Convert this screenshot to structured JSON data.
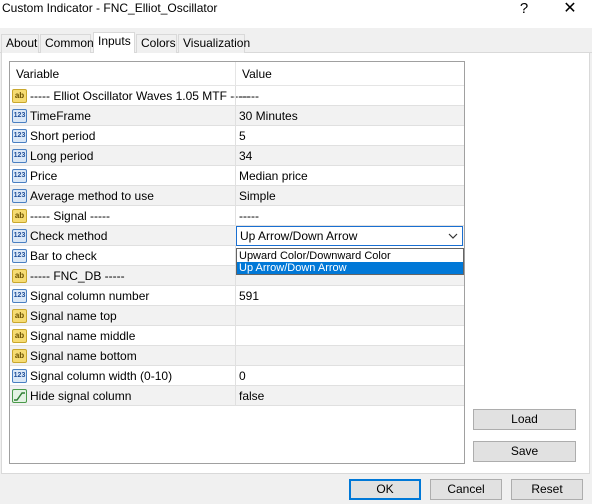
{
  "window": {
    "title": "Custom Indicator - FNC_Elliot_Oscillator",
    "help_glyph": "?",
    "close_glyph": "✕"
  },
  "tabs": [
    {
      "label": "About",
      "active": false
    },
    {
      "label": "Common",
      "active": false
    },
    {
      "label": "Inputs",
      "active": true
    },
    {
      "label": "Colors",
      "active": false
    },
    {
      "label": "Visualization",
      "active": false
    }
  ],
  "grid": {
    "header": {
      "variable": "Variable",
      "value": "Value"
    },
    "rows": [
      {
        "icon": "ab-icon",
        "variable": "----- Elliot Oscillator Waves 1.05 MTF -----",
        "value": "-----"
      },
      {
        "icon": "numeric-icon",
        "variable": "TimeFrame",
        "value": "30 Minutes"
      },
      {
        "icon": "numeric-icon",
        "variable": "Short period",
        "value": "5"
      },
      {
        "icon": "numeric-icon",
        "variable": "Long period",
        "value": "34"
      },
      {
        "icon": "numeric-icon",
        "variable": "Price",
        "value": "Median price"
      },
      {
        "icon": "numeric-icon",
        "variable": "Average method to use",
        "value": "Simple"
      },
      {
        "icon": "ab-icon",
        "variable": "----- Signal -----",
        "value": "-----"
      },
      {
        "icon": "numeric-icon",
        "variable": "Check method",
        "value": "Up Arrow/Down Arrow"
      },
      {
        "icon": "numeric-icon",
        "variable": "Bar to check",
        "value": ""
      },
      {
        "icon": "ab-icon",
        "variable": "----- FNC_DB -----",
        "value": ""
      },
      {
        "icon": "numeric-icon",
        "variable": "Signal column number",
        "value": "591"
      },
      {
        "icon": "ab-icon",
        "variable": "Signal name top",
        "value": ""
      },
      {
        "icon": "ab-icon",
        "variable": "Signal name middle",
        "value": ""
      },
      {
        "icon": "ab-icon",
        "variable": "Signal name bottom",
        "value": ""
      },
      {
        "icon": "numeric-icon",
        "variable": "Signal column width (0-10)",
        "value": "0"
      },
      {
        "icon": "boolean-icon",
        "variable": "Hide signal column",
        "value": "false"
      }
    ]
  },
  "dropdown": {
    "options": [
      "Upward Color/Downward Color",
      "Up Arrow/Down Arrow"
    ],
    "selected": "Up Arrow/Down Arrow"
  },
  "buttons": {
    "load": "Load",
    "save": "Save",
    "ok": "OK",
    "cancel": "Cancel",
    "reset": "Reset"
  },
  "colors": {
    "selection": "#0078d7",
    "combo_border": "#1a6fd1"
  }
}
